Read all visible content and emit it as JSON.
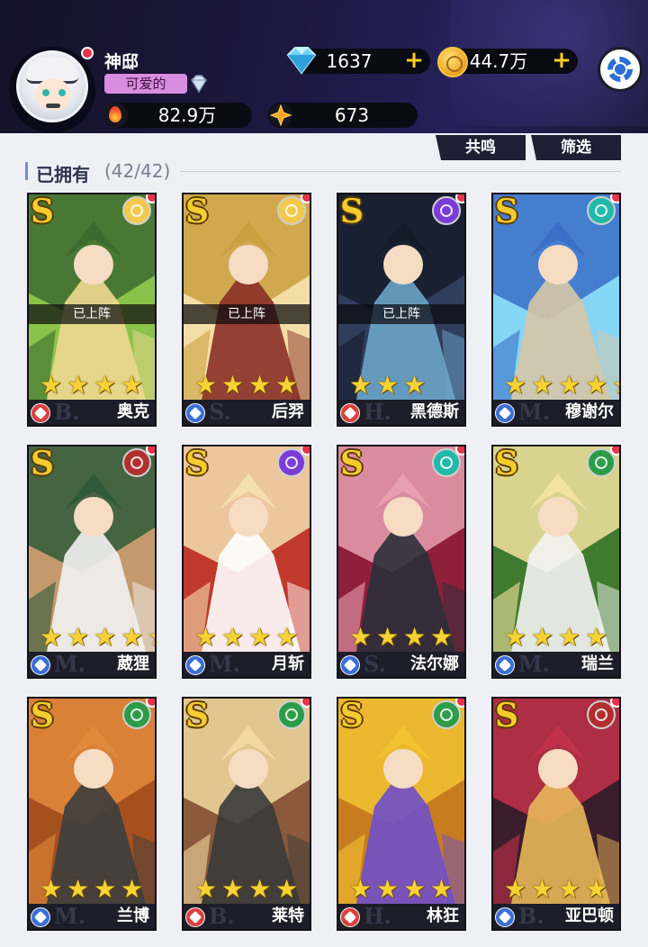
{
  "player": {
    "name": "神邸",
    "title": "可爱的",
    "avatar": "player-avatar",
    "diamonds": "1637",
    "gold": "44.7万",
    "power": "82.9万",
    "stars": "673"
  },
  "icons": {
    "plus": "+",
    "diamond": "diamond-icon",
    "coin": "gold-coin-icon",
    "fire": "flame-icon",
    "star_gem": "star-gem-icon",
    "settings": "gear-icon"
  },
  "filter_bar": {
    "resonance_label": "共鸣",
    "filter_label": "筛选",
    "owned_label": "已拥有",
    "owned_count": "(42/42)"
  },
  "hero_common": {
    "grade": "S",
    "deployed_label": "已上阵",
    "star_char": "★"
  },
  "heroes": [
    {
      "name": "奥克",
      "stars": 4,
      "deployed": true,
      "faction": "light",
      "faction_color": "#f2c94c",
      "role": "tank",
      "role_color": "#d9413e",
      "class_mark": "B.",
      "art": [
        "#3c6b2f",
        "#8bc34a",
        "#f0d890"
      ]
    },
    {
      "name": "后羿",
      "stars": 4,
      "deployed": true,
      "faction": "light",
      "faction_color": "#f2c94c",
      "role": "archer",
      "role_color": "#3b6fd6",
      "class_mark": "S.",
      "art": [
        "#c9a040",
        "#f3dfa6",
        "#8a2f28"
      ]
    },
    {
      "name": "黑德斯",
      "stars": 3,
      "deployed": true,
      "faction": "dark",
      "faction_color": "#7b3bd6",
      "role": "assassin",
      "role_color": "#d9413e",
      "class_mark": "H.",
      "art": [
        "#151b2a",
        "#2f3e5c",
        "#6ba4c7"
      ]
    },
    {
      "name": "穆谢尔",
      "stars": 5,
      "deployed": false,
      "faction": "water",
      "faction_color": "#23b9a8",
      "role": "archer",
      "role_color": "#3b6fd6",
      "class_mark": "M.",
      "art": [
        "#3a6fc7",
        "#86d6f5",
        "#d6c7a8"
      ]
    },
    {
      "name": "葳狸",
      "stars": 5,
      "deployed": false,
      "faction": "fire",
      "faction_color": "#b22f2f",
      "role": "support",
      "role_color": "#3b6fd6",
      "class_mark": "M.",
      "art": [
        "#2f5a3a",
        "#c49a6c",
        "#f2f2f2"
      ]
    },
    {
      "name": "月斩",
      "stars": 4,
      "deployed": false,
      "faction": "dark",
      "faction_color": "#7b3bd6",
      "role": "warrior",
      "role_color": "#3b6fd6",
      "class_mark": "M.",
      "art": [
        "#f3dfb0",
        "#c0392b",
        "#ffffff"
      ]
    },
    {
      "name": "法尔娜",
      "stars": 4,
      "deployed": false,
      "faction": "water",
      "faction_color": "#23b9a8",
      "role": "archer",
      "role_color": "#3b6fd6",
      "class_mark": "S.",
      "art": [
        "#e8a0b0",
        "#8f1f3a",
        "#2a2f3a"
      ]
    },
    {
      "name": "瑞兰",
      "stars": 4,
      "deployed": false,
      "faction": "nature",
      "faction_color": "#2c9c48",
      "role": "support",
      "role_color": "#3b6fd6",
      "class_mark": "M.",
      "art": [
        "#f3e3a0",
        "#3f7a2e",
        "#f4f4f4"
      ]
    },
    {
      "name": "兰博",
      "stars": 4,
      "deployed": false,
      "faction": "nature",
      "faction_color": "#2c9c48",
      "role": "warrior",
      "role_color": "#3b6fd6",
      "class_mark": "M.",
      "art": [
        "#e08a3c",
        "#a6501e",
        "#3d3d3d"
      ]
    },
    {
      "name": "莱特",
      "stars": 4,
      "deployed": false,
      "faction": "nature",
      "faction_color": "#2c9c48",
      "role": "archer",
      "role_color": "#d9413e",
      "class_mark": "B.",
      "art": [
        "#f1d9a0",
        "#8a5a3a",
        "#3a3a3a"
      ]
    },
    {
      "name": "林狂",
      "stars": 4,
      "deployed": false,
      "faction": "nature",
      "faction_color": "#2c9c48",
      "role": "tank",
      "role_color": "#d9413e",
      "class_mark": "H.",
      "art": [
        "#f2c233",
        "#c77d1e",
        "#6f4fc9"
      ]
    },
    {
      "name": "亚巴顿",
      "stars": 4,
      "deployed": false,
      "faction": "fire",
      "faction_color": "#b22f2f",
      "role": "tank",
      "role_color": "#3b6fd6",
      "class_mark": "B.",
      "art": [
        "#c2314a",
        "#3a1d2a",
        "#e8b85a"
      ]
    }
  ]
}
